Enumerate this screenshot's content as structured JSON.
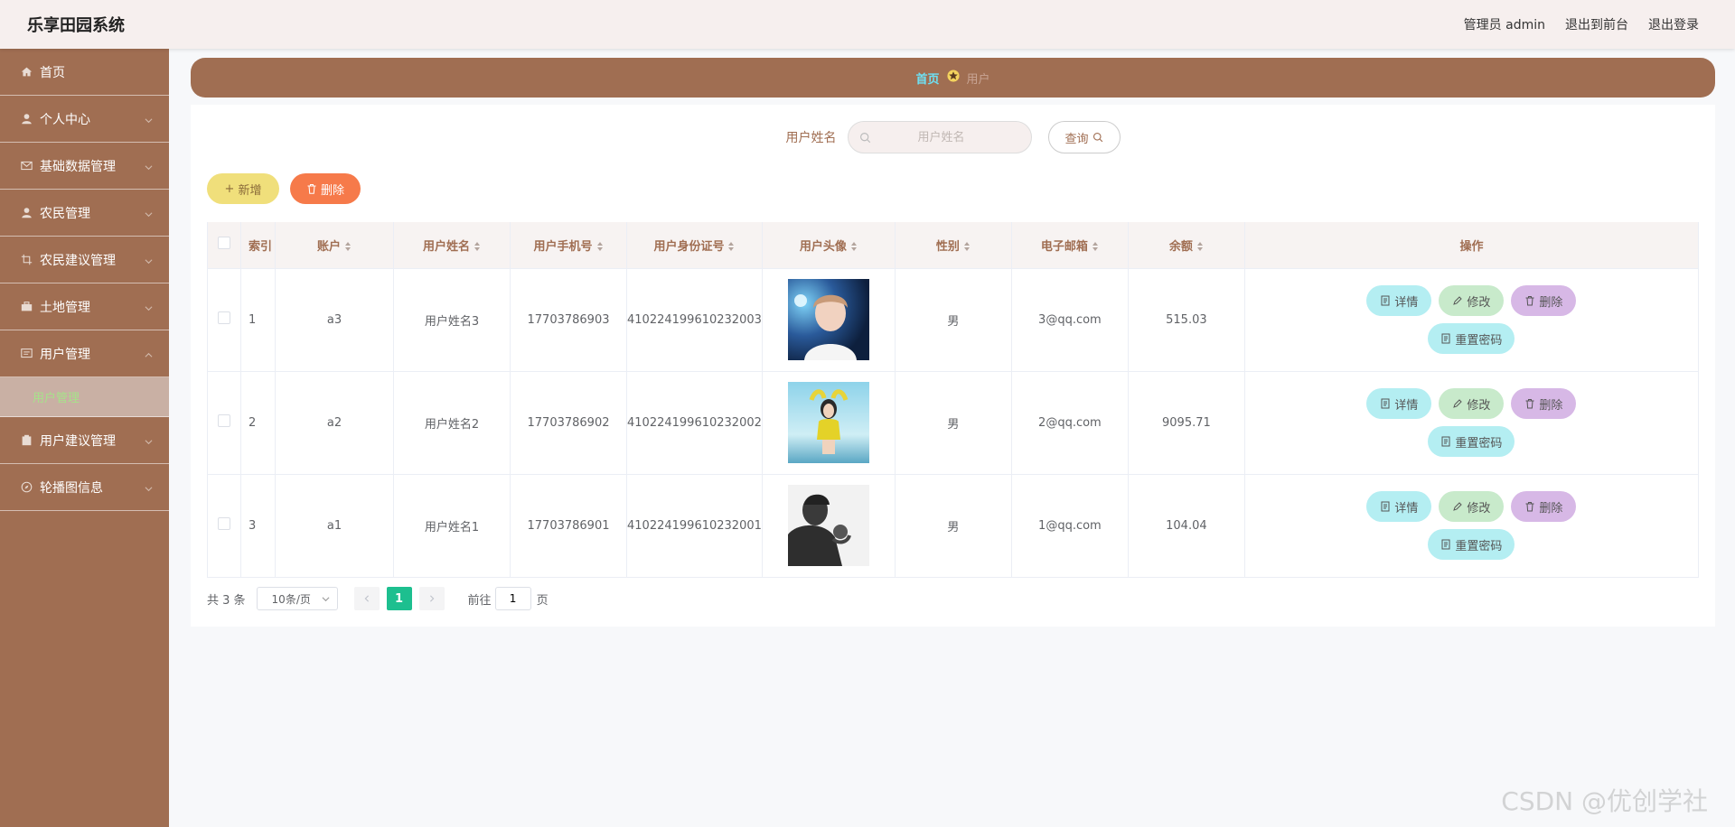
{
  "app": {
    "title": "乐享田园系统"
  },
  "header": {
    "user": "管理员 admin",
    "front": "退出到前台",
    "logout": "退出登录"
  },
  "sidebar": {
    "items": [
      {
        "label": "首页"
      },
      {
        "label": "个人中心"
      },
      {
        "label": "基础数据管理"
      },
      {
        "label": "农民管理"
      },
      {
        "label": "农民建议管理"
      },
      {
        "label": "土地管理"
      },
      {
        "label": "用户管理"
      },
      {
        "label": "用户建议管理"
      },
      {
        "label": "轮播图信息"
      }
    ],
    "sub_active": "用户管理"
  },
  "breadcrumb": {
    "home": "首页",
    "current": "用户"
  },
  "search": {
    "label": "用户姓名",
    "placeholder": "用户姓名",
    "button": "查询"
  },
  "actions": {
    "add": "新增",
    "delete": "删除"
  },
  "table": {
    "headers": [
      "索引",
      "账户",
      "用户姓名",
      "用户手机号",
      "用户身份证号",
      "用户头像",
      "性别",
      "电子邮箱",
      "余额",
      "操作"
    ],
    "rows": [
      {
        "index": "1",
        "account": "a3",
        "name": "用户姓名3",
        "phone": "17703786903",
        "id_card": "410224199610232003",
        "gender": "男",
        "email": "3@qq.com",
        "balance": "515.03"
      },
      {
        "index": "2",
        "account": "a2",
        "name": "用户姓名2",
        "phone": "17703786902",
        "id_card": "410224199610232002",
        "gender": "男",
        "email": "2@qq.com",
        "balance": "9095.71"
      },
      {
        "index": "3",
        "account": "a1",
        "name": "用户姓名1",
        "phone": "17703786901",
        "id_card": "410224199610232001",
        "gender": "男",
        "email": "1@qq.com",
        "balance": "104.04"
      }
    ],
    "ops": {
      "detail": "详情",
      "edit": "修改",
      "delete": "删除",
      "reset": "重置密码"
    }
  },
  "pager": {
    "total": "共 3 条",
    "page_size": "10条/页",
    "current": "1",
    "goto_label": "前往",
    "goto_value": "1",
    "page_unit": "页"
  },
  "watermark": "CSDN @优创学社",
  "colors": {
    "sidebar": "#a06e52",
    "accent": "#1dbf8f",
    "header_bg": "#f6efee"
  }
}
